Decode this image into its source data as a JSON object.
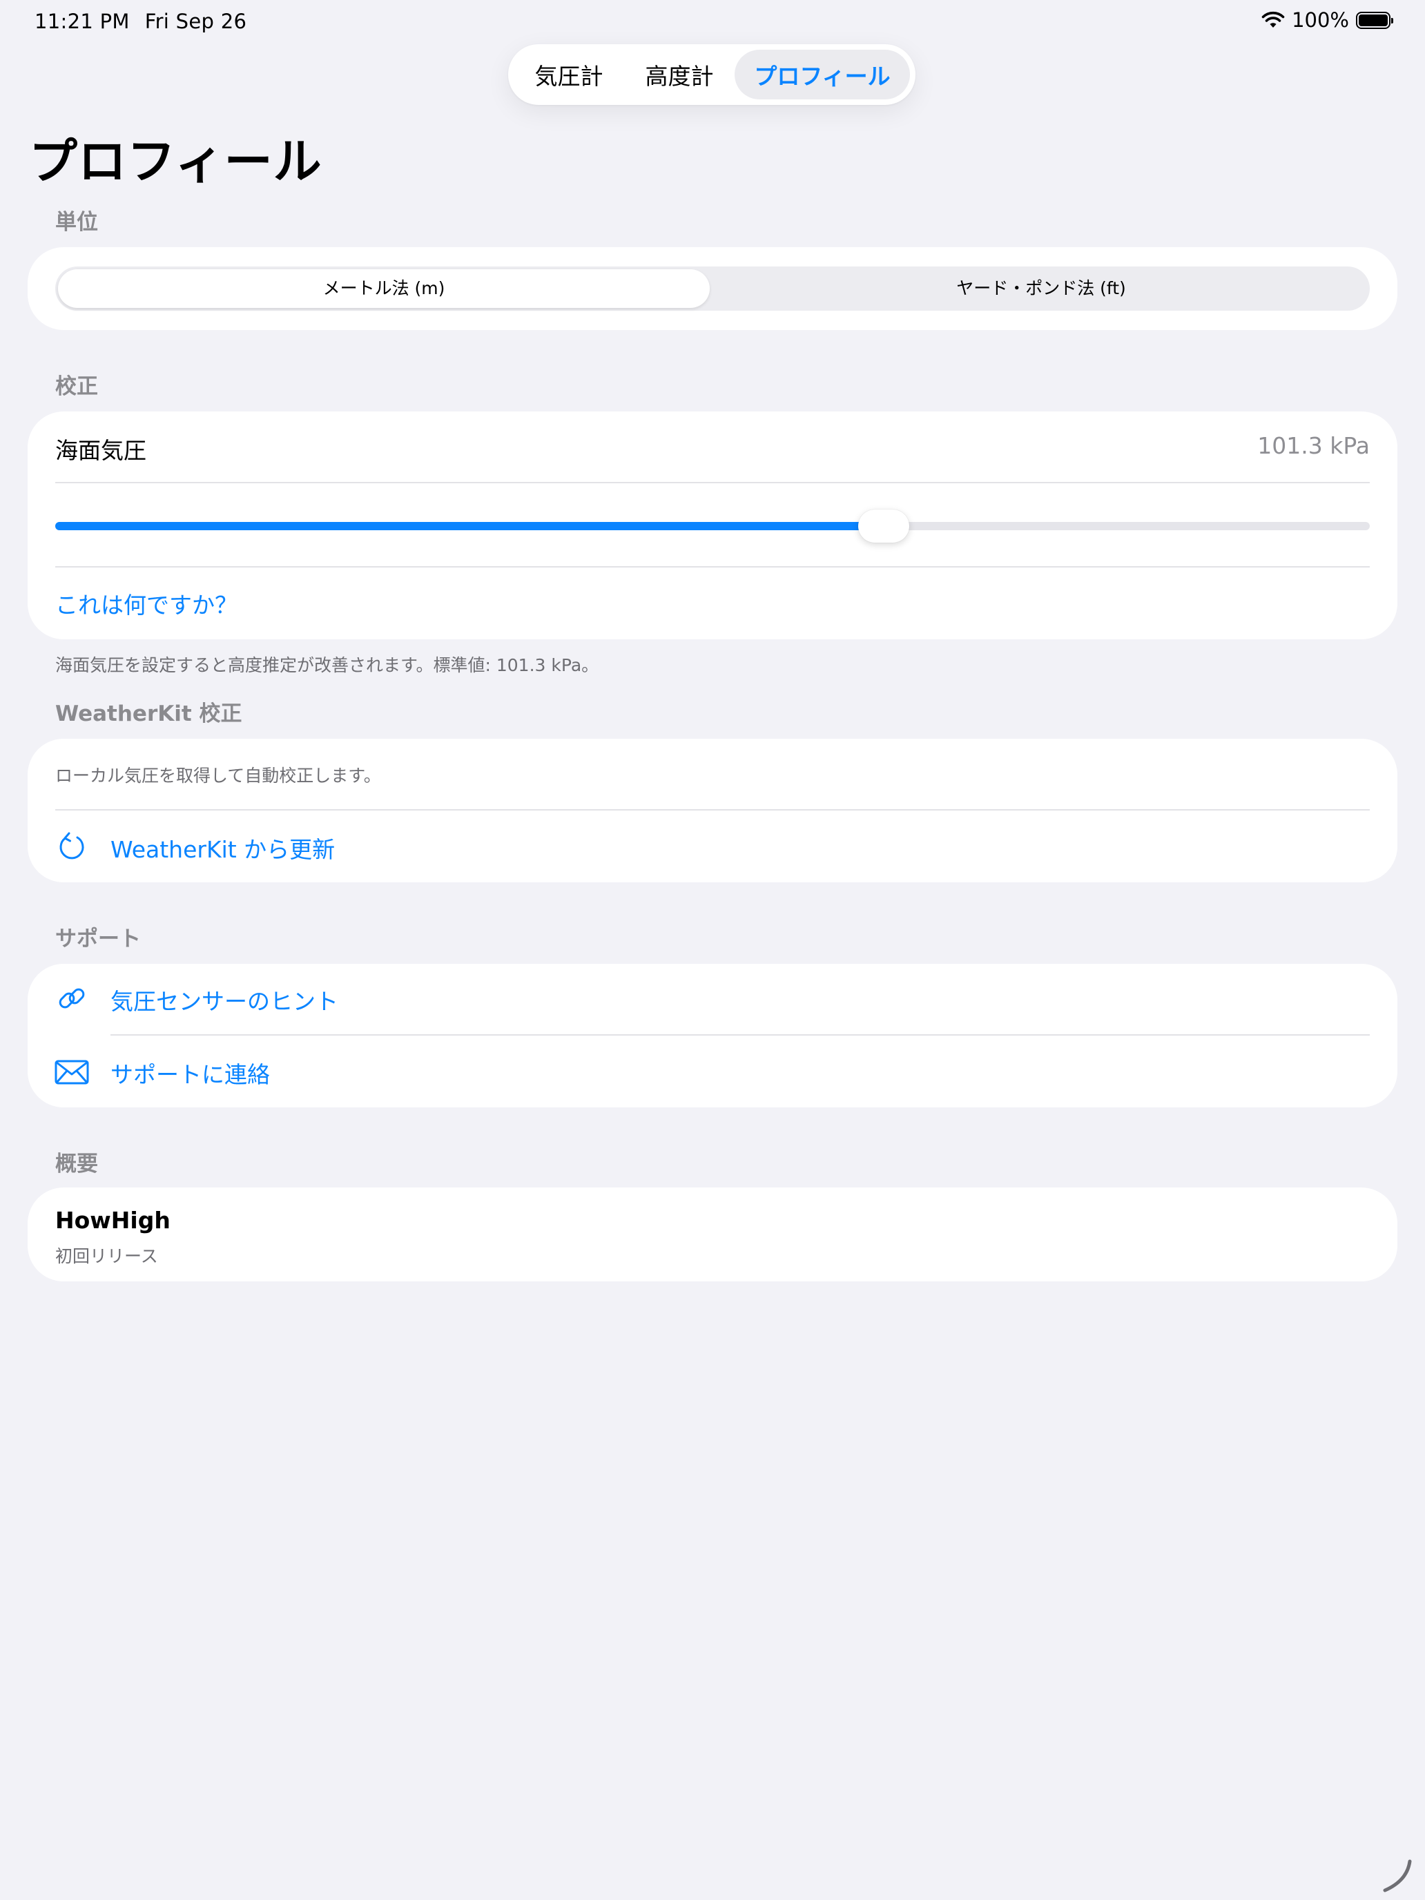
{
  "status_bar": {
    "time": "11:21 PM",
    "date": "Fri Sep 26",
    "battery": "100%"
  },
  "tabs": [
    {
      "label": "気圧計",
      "selected": false
    },
    {
      "label": "高度計",
      "selected": false
    },
    {
      "label": "プロフィール",
      "selected": true
    }
  ],
  "page_title": "プロフィール",
  "units": {
    "header": "単位",
    "options": [
      "メートル法 (m)",
      "ヤード・ポンド法 (ft)"
    ],
    "selected_index": 0
  },
  "calibration": {
    "header": "校正",
    "label": "海面気圧",
    "value": "101.3 kPa",
    "slider_fraction": 0.63,
    "help_link": "これは何ですか？",
    "footnote": "海面気圧を設定すると高度推定が改善されます。標準値: 101.3 kPa。"
  },
  "weatherkit": {
    "header": "WeatherKit 校正",
    "description": "ローカル気圧を取得して自動校正します。",
    "refresh_label": "WeatherKit から更新",
    "icon": "refresh-icon"
  },
  "support": {
    "header": "サポート",
    "items": [
      {
        "label": "気圧センサーのヒント",
        "icon": "link-icon"
      },
      {
        "label": "サポートに連絡",
        "icon": "envelope-icon"
      }
    ]
  },
  "about": {
    "header": "概要",
    "app_name": "HowHigh",
    "subtitle": "初回リリース"
  },
  "colors": {
    "accent": "#0a84ff",
    "background": "#f2f2f7",
    "card": "#ffffff",
    "secondary_text": "#8e8e93"
  }
}
